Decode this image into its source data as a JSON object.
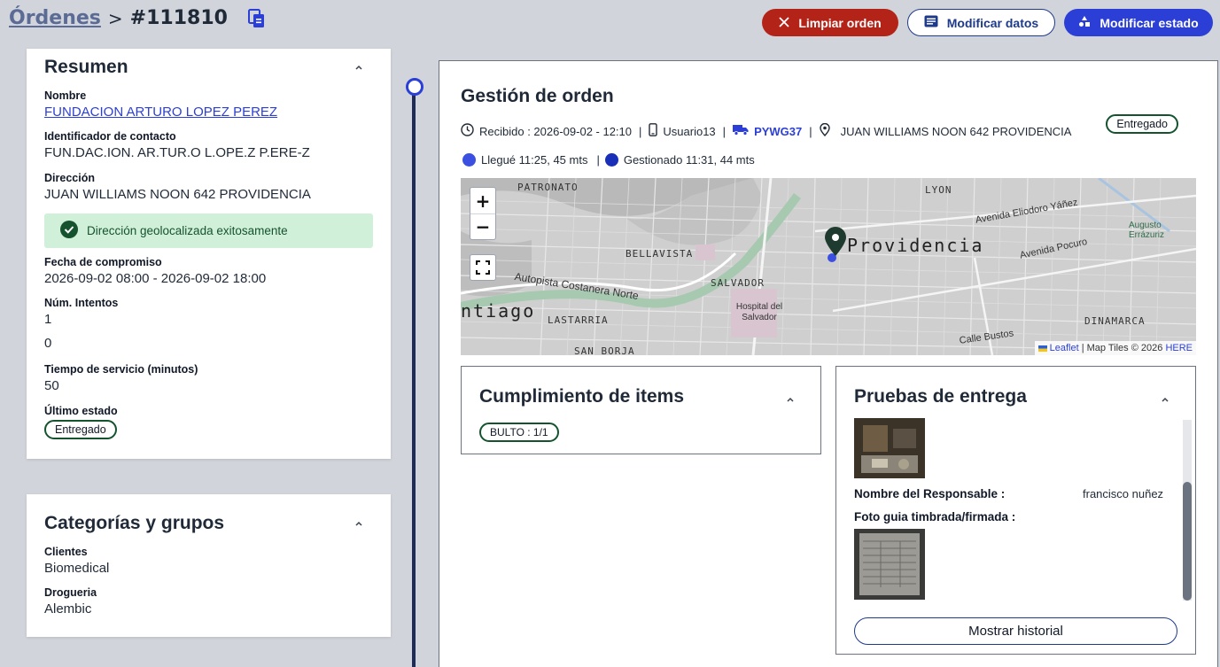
{
  "breadcrumb": {
    "parent": "Órdenes",
    "separator": ">",
    "current": "#111810"
  },
  "actions": {
    "clear_order": "Limpiar orden",
    "edit_data": "Modificar datos",
    "edit_status": "Modificar estado"
  },
  "summary": {
    "title": "Resumen",
    "name_label": "Nombre",
    "name_value": "FUNDACION ARTURO LOPEZ PEREZ",
    "contact_id_label": "Identificador de contacto",
    "contact_id_value": "FUN.DAC.ION. AR.TUR.O L.OPE.Z P.ERE-Z",
    "address_label": "Dirección",
    "address_value": "JUAN WILLIAMS NOON 642 PROVIDENCIA",
    "geo_success": "Dirección geolocalizada exitosamente",
    "commit_label": "Fecha de compromiso",
    "commit_value": "2026-09-02 08:00 - 2026-09-02 18:00",
    "attempts_label": "Núm. Intentos",
    "attempts_value": "1",
    "extra_value": "0",
    "service_label": "Tiempo de servicio (minutos)",
    "service_value": "50",
    "last_status_label": "Último estado",
    "last_status_value": "Entregado"
  },
  "categories": {
    "title": "Categorías y grupos",
    "clients_label": "Clientes",
    "clients_value": "Biomedical",
    "pharmacy_label": "Drogueria",
    "pharmacy_value": "Alembic"
  },
  "order": {
    "title": "Gestión de orden",
    "received": "Recibido : 2026-09-02 - 12:10",
    "user": "Usuario13",
    "plate": "PYWG37",
    "address": "JUAN WILLIAMS NOON 642 PROVIDENCIA",
    "status": "Entregado",
    "arrived": "Llegué 11:25, 45 mts",
    "managed": "Gestionado 11:31, 44 mts",
    "arrived_color": "#3b4fe0",
    "managed_color": "#1a2fb8"
  },
  "map": {
    "zoom_in": "+",
    "zoom_out": "−",
    "leaflet": "Leaflet",
    "tiles": "| Map Tiles © 2026",
    "here": "HERE",
    "labels": {
      "patronato": "PATRONATO",
      "lyon": "LYON",
      "bellavista": "BELLAVISTA",
      "providencia": "Providencia",
      "salvador": "SALVADOR",
      "santiago": "ntiago",
      "lastarria": "LASTARRIA",
      "dinamarca": "DINAMARCA",
      "hospital": "Hospital del Salvador",
      "autopista": "Autopista Costanera Norte",
      "pocuro": "Avenida Pocuro",
      "eliodoro": "Avenida Eliodoro Yáñez",
      "bustos": "Calle Bustos",
      "san_borja": "SAN BORJA",
      "augusto": "Augusto Errázuriz"
    }
  },
  "items": {
    "title": "Cumplimiento de items",
    "badge": "BULTO : 1/1"
  },
  "proofs": {
    "title": "Pruebas de entrega",
    "responsible_label": "Nombre del Responsable :",
    "responsible_value": "francisco nuñez",
    "photo_label": "Foto guia timbrada/firmada :",
    "history_button": "Mostrar historial"
  }
}
